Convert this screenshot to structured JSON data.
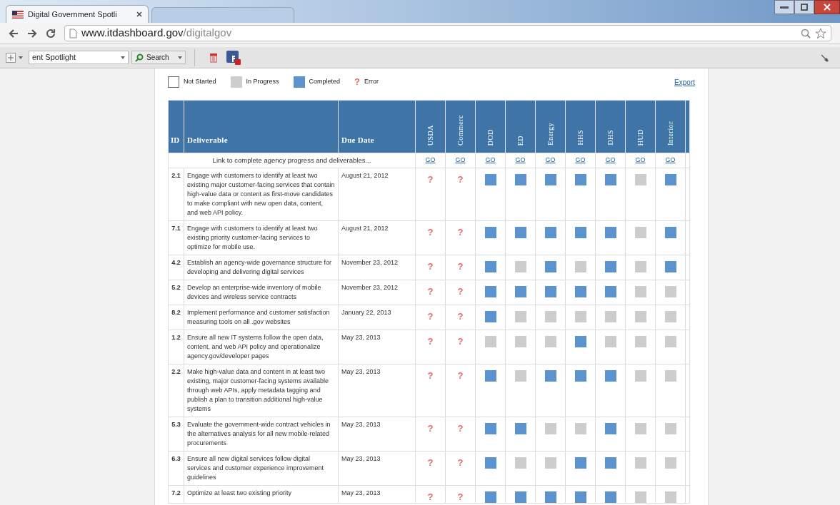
{
  "browser": {
    "tab_title": "Digital Government Spotli",
    "url_host": "www.itdashboard.gov",
    "url_path": "/digitalgov",
    "toolbar_field": "ent Spotlight",
    "search_button": "Search"
  },
  "legend": [
    {
      "kind": "not_started",
      "label": "Not Started"
    },
    {
      "kind": "in_progress",
      "label": "In Progress"
    },
    {
      "kind": "completed",
      "label": "Completed"
    },
    {
      "kind": "error",
      "label": "Error",
      "symbol": "?"
    }
  ],
  "export_link": "Export",
  "table": {
    "columns": [
      "ID",
      "Deliverable",
      "Due Date"
    ],
    "agencies": [
      "USDA",
      "Commerc",
      "DOD",
      "ED",
      "Energy",
      "HHS",
      "DHS",
      "HUD",
      "Interior"
    ],
    "link_row": {
      "label": "Link to complete agency progress and deliverables...",
      "links": [
        "GO",
        "GO",
        "GO",
        "GO",
        "GO",
        "GO",
        "GO",
        "GO",
        "GO"
      ]
    },
    "rows": [
      {
        "id": "2.1",
        "deliverable": "Engage with customers to identify at least two existing major customer-facing services that contain high-value data or content as first-move candidates to make compliant with new open data, content, and web API policy.",
        "due": "August 21, 2012",
        "cells": [
          {
            "kind": "error",
            "text": "?"
          },
          {
            "kind": "error",
            "text": "?"
          },
          {
            "kind": "completed"
          },
          {
            "kind": "completed"
          },
          {
            "kind": "completed"
          },
          {
            "kind": "completed"
          },
          {
            "kind": "completed"
          },
          {
            "kind": "in_progress"
          },
          {
            "kind": "completed"
          }
        ]
      },
      {
        "id": "7.1",
        "deliverable": "Engage with customers to identify at least two existing priority customer-facing services to optimize for mobile use.",
        "due": "August 21, 2012",
        "cells": [
          {
            "kind": "error",
            "text": "?"
          },
          {
            "kind": "error",
            "text": "?"
          },
          {
            "kind": "completed"
          },
          {
            "kind": "completed"
          },
          {
            "kind": "completed"
          },
          {
            "kind": "completed"
          },
          {
            "kind": "completed"
          },
          {
            "kind": "in_progress"
          },
          {
            "kind": "completed"
          }
        ]
      },
      {
        "id": "4.2",
        "deliverable": "Establish an agency-wide governance structure for developing and delivering digital services",
        "due": "November 23, 2012",
        "cells": [
          {
            "kind": "error",
            "text": "?"
          },
          {
            "kind": "error",
            "text": "?"
          },
          {
            "kind": "completed"
          },
          {
            "kind": "in_progress"
          },
          {
            "kind": "completed"
          },
          {
            "kind": "in_progress"
          },
          {
            "kind": "completed"
          },
          {
            "kind": "in_progress"
          },
          {
            "kind": "completed"
          }
        ]
      },
      {
        "id": "5.2",
        "deliverable": "Develop an enterprise-wide inventory of mobile devices and wireless service contracts",
        "due": "November 23, 2012",
        "cells": [
          {
            "kind": "error",
            "text": "?"
          },
          {
            "kind": "error",
            "text": "?"
          },
          {
            "kind": "completed"
          },
          {
            "kind": "completed"
          },
          {
            "kind": "completed"
          },
          {
            "kind": "completed"
          },
          {
            "kind": "completed"
          },
          {
            "kind": "in_progress"
          },
          {
            "kind": "in_progress"
          }
        ]
      },
      {
        "id": "8.2",
        "deliverable": "Implement performance and customer satisfaction measuring tools on all .gov websites",
        "due": "January 22, 2013",
        "cells": [
          {
            "kind": "error",
            "text": "?"
          },
          {
            "kind": "error",
            "text": "?"
          },
          {
            "kind": "completed"
          },
          {
            "kind": "in_progress"
          },
          {
            "kind": "in_progress"
          },
          {
            "kind": "in_progress"
          },
          {
            "kind": "in_progress"
          },
          {
            "kind": "in_progress"
          },
          {
            "kind": "in_progress"
          }
        ]
      },
      {
        "id": "1.2",
        "deliverable": "Ensure all new IT systems follow the open data, content, and web API policy and operationalize agency.gov/developer pages",
        "due": "May 23, 2013",
        "cells": [
          {
            "kind": "error",
            "text": "?"
          },
          {
            "kind": "error",
            "text": "?"
          },
          {
            "kind": "in_progress"
          },
          {
            "kind": "in_progress"
          },
          {
            "kind": "in_progress"
          },
          {
            "kind": "completed"
          },
          {
            "kind": "in_progress"
          },
          {
            "kind": "in_progress"
          },
          {
            "kind": "in_progress"
          }
        ]
      },
      {
        "id": "2.2",
        "deliverable": "Make high-value data and content in at least two existing, major customer-facing systems available through web APIs, apply metadata tagging and publish a plan to transition additional high-value systems",
        "due": "May 23, 2013",
        "cells": [
          {
            "kind": "error",
            "text": "?"
          },
          {
            "kind": "error",
            "text": "?"
          },
          {
            "kind": "completed"
          },
          {
            "kind": "in_progress"
          },
          {
            "kind": "completed"
          },
          {
            "kind": "completed"
          },
          {
            "kind": "completed"
          },
          {
            "kind": "in_progress"
          },
          {
            "kind": "in_progress"
          }
        ]
      },
      {
        "id": "5.3",
        "deliverable": "Evaluate the government-wide contract vehicles in the alternatives analysis for all new mobile-related procurements",
        "due": "May 23, 2013",
        "cells": [
          {
            "kind": "error",
            "text": "?"
          },
          {
            "kind": "error",
            "text": "?"
          },
          {
            "kind": "completed"
          },
          {
            "kind": "completed"
          },
          {
            "kind": "in_progress"
          },
          {
            "kind": "in_progress"
          },
          {
            "kind": "completed"
          },
          {
            "kind": "in_progress"
          },
          {
            "kind": "in_progress"
          }
        ]
      },
      {
        "id": "6.3",
        "deliverable": "Ensure all new digital services follow digital services and customer experience improvement guidelines",
        "due": "May 23, 2013",
        "cells": [
          {
            "kind": "error",
            "text": "?"
          },
          {
            "kind": "error",
            "text": "?"
          },
          {
            "kind": "completed"
          },
          {
            "kind": "in_progress"
          },
          {
            "kind": "in_progress"
          },
          {
            "kind": "completed"
          },
          {
            "kind": "completed"
          },
          {
            "kind": "in_progress"
          },
          {
            "kind": "in_progress"
          }
        ]
      },
      {
        "id": "7.2",
        "deliverable": "Optimize at least two existing priority",
        "due": "May 23, 2013",
        "cells": [
          {
            "kind": "error",
            "text": "?"
          },
          {
            "kind": "error",
            "text": "?"
          },
          {
            "kind": "completed"
          },
          {
            "kind": "completed"
          },
          {
            "kind": "completed"
          },
          {
            "kind": "completed"
          },
          {
            "kind": "completed"
          },
          {
            "kind": "in_progress"
          },
          {
            "kind": "in_progress"
          }
        ]
      }
    ]
  }
}
